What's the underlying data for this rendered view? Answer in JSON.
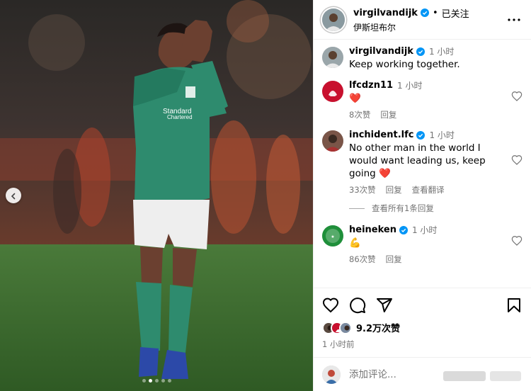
{
  "post": {
    "author": "virgilvandijk",
    "follow_label": "已关注",
    "location": "伊斯坦布尔",
    "separator": "•"
  },
  "icons": {
    "verified": "verified-badge-icon",
    "more": "more-options-icon",
    "prev": "chevron-left-icon",
    "heart": "heart-outline-icon",
    "comment": "comment-icon",
    "share": "send-icon",
    "save": "bookmark-icon"
  },
  "colors": {
    "verified_blue": "#0095f6",
    "jersey_green": "#2e8b6e",
    "heart_red": "#e8313a",
    "lfc_red": "#c8102e",
    "heineken_green": "#1f8f3a"
  },
  "comments": [
    {
      "user": "virgilvandijk",
      "verified": true,
      "time": "1 小时",
      "text": "Keep working together.",
      "likes": "",
      "reply": ""
    },
    {
      "user": "lfcdzn11",
      "verified": false,
      "time": "1 小时",
      "text": "❤️",
      "likes": "8次赞",
      "reply": "回复"
    },
    {
      "user": "inchident.lfc",
      "verified": true,
      "time": "1 小时",
      "text": "No other man in the world I would want leading us, keep going ❤️",
      "likes": "33次赞",
      "reply": "回复",
      "translate": "查看翻译"
    },
    {
      "user": "heineken",
      "verified": true,
      "time": "1 小时",
      "text": "💪",
      "likes": "86次赞",
      "reply": "回复"
    }
  ],
  "view_replies": "查看所有1条回复",
  "engagement": {
    "likes": "9.2万次赞",
    "post_time": "1 小时前"
  },
  "comment_box": {
    "placeholder": "添加评论..."
  },
  "carousel": {
    "total": 5,
    "active": 1
  }
}
